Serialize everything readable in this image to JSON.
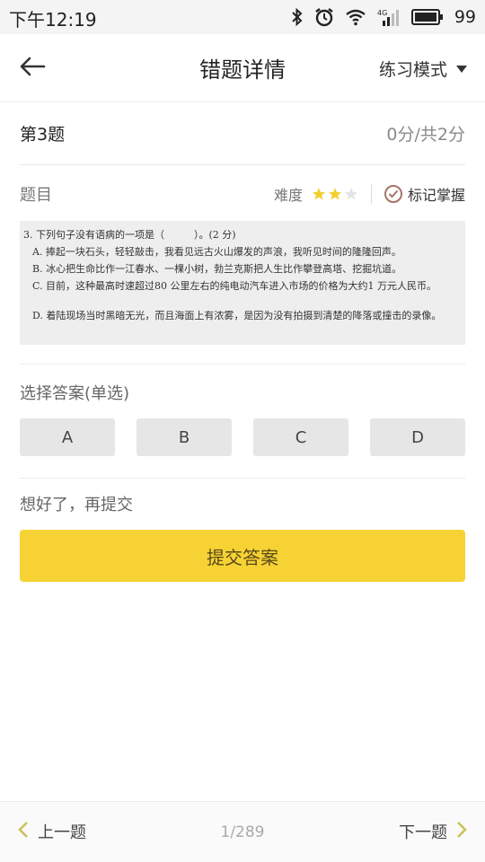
{
  "status_bar": {
    "time": "下午12:19",
    "battery": "99",
    "network": "4G"
  },
  "header": {
    "title": "错题详情",
    "mode_label": "练习模式"
  },
  "question": {
    "number_label": "第3题",
    "score_label": "0分/共2分",
    "subject_label": "题目",
    "difficulty_label": "难度",
    "difficulty_stars": 2,
    "difficulty_max": 3,
    "mark_label": "标记掌握",
    "content": {
      "stem": "3. 下列句子没有语病的一项是（　　　）。(2 分)",
      "option_a": "A. 捧起一块石头，轻轻敲击，我看见远古火山爆发的声浪，我听见时间的隆隆回声。",
      "option_b": "B. 冰心把生命比作一江春水、一棵小树，勃兰克斯把人生比作攀登高塔、挖掘坑道。",
      "option_c": "C. 目前，这种最高时速超过80 公里左右的纯电动汽车进入市场的价格为大约1 万元人民币。",
      "option_d": "D. 着陆现场当时黑暗无光，而且海面上有浓雾，是因为没有拍摄到清楚的降落或撞击的录像。"
    }
  },
  "answer": {
    "label": "选择答案(单选)",
    "options": [
      "A",
      "B",
      "C",
      "D"
    ]
  },
  "submit": {
    "hint": "想好了，再提交",
    "button_label": "提交答案"
  },
  "footer": {
    "prev_label": "上一题",
    "page_indicator": "1/289",
    "next_label": "下一题"
  },
  "colors": {
    "accent_yellow": "#f7d234",
    "star_active": "#f2cf2c",
    "star_inactive": "#e4e4e4",
    "chevron": "#c9c25a",
    "check": "#a6736a"
  }
}
